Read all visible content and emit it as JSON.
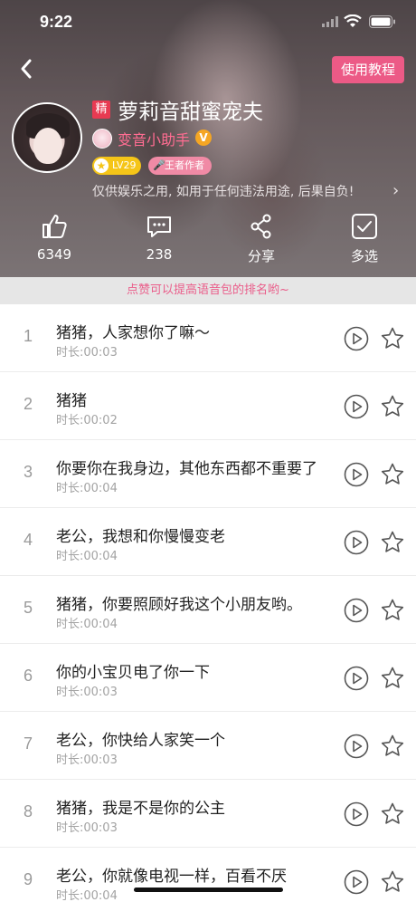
{
  "status_bar": {
    "time": "9:22"
  },
  "header": {
    "tutorial_label": "使用教程",
    "tag": "精",
    "title": "萝莉音甜蜜宠夫",
    "author": "变音小助手",
    "verified_mark": "V",
    "level_badge": "LV29",
    "role_badge": "王者作者",
    "disclaimer": "仅供娱乐之用, 如用于任何违法用途, 后果自负!",
    "disclaimer_arrow": "›"
  },
  "actions": {
    "like_count": "6349",
    "comment_count": "238",
    "share_label": "分享",
    "multi_label": "多选"
  },
  "hint": "点赞可以提高语音包的排名哟~",
  "items": [
    {
      "num": "1",
      "name": "猪猪，人家想你了嘛～",
      "duration": "时长:00:03"
    },
    {
      "num": "2",
      "name": "猪猪",
      "duration": "时长:00:02"
    },
    {
      "num": "3",
      "name": "你要你在我身边，其他东西都不重要了",
      "duration": "时长:00:04"
    },
    {
      "num": "4",
      "name": "老公，我想和你慢慢变老",
      "duration": "时长:00:04"
    },
    {
      "num": "5",
      "name": "猪猪，你要照顾好我这个小朋友哟。",
      "duration": "时长:00:04"
    },
    {
      "num": "6",
      "name": "你的小宝贝电了你一下",
      "duration": "时长:00:03"
    },
    {
      "num": "7",
      "name": "老公，你快给人家笑一个",
      "duration": "时长:00:03"
    },
    {
      "num": "8",
      "name": "猪猪，我是不是你的公主",
      "duration": "时长:00:03"
    },
    {
      "num": "9",
      "name": "老公，你就像电视一样，百看不厌",
      "duration": "时长:00:04"
    }
  ],
  "icons": {
    "back": "chevron-left-icon",
    "play": "play-circle-icon",
    "favorite": "star-outline-icon",
    "like": "thumbs-up-icon",
    "comment": "comment-icon",
    "share": "share-icon",
    "multi_select": "checkbox-icon"
  },
  "colors": {
    "accent_pink": "#ec5a86",
    "author_pink": "#ff6d92",
    "level_yellow": "#f5c518",
    "tag_red": "#e83a52"
  }
}
